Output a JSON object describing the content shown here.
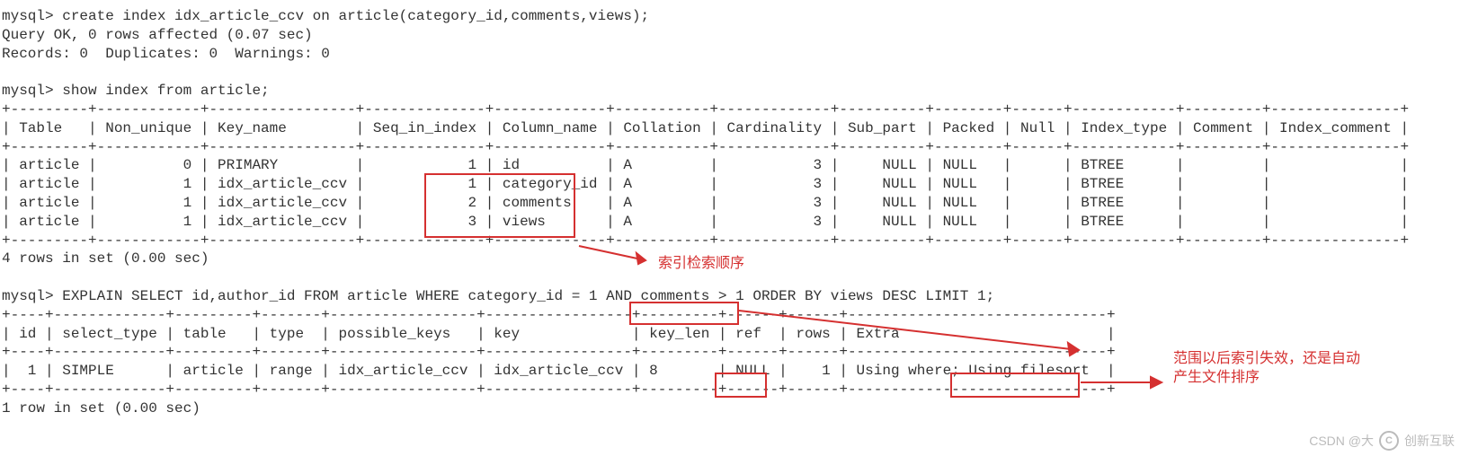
{
  "lines": {
    "l01": "mysql> create index idx_article_ccv on article(category_id,comments,views);",
    "l02": "Query OK, 0 rows affected (0.07 sec)",
    "l03": "Records: 0  Duplicates: 0  Warnings: 0",
    "l04": "",
    "l05": "mysql> show index from article;",
    "l06": "+---------+------------+-----------------+--------------+-------------+-----------+-------------+----------+--------+------+------------+---------+---------------+",
    "l07": "| Table   | Non_unique | Key_name        | Seq_in_index | Column_name | Collation | Cardinality | Sub_part | Packed | Null | Index_type | Comment | Index_comment |",
    "l08": "+---------+------------+-----------------+--------------+-------------+-----------+-------------+----------+--------+------+------------+---------+---------------+",
    "l09": "| article |          0 | PRIMARY         |            1 | id          | A         |           3 |     NULL | NULL   |      | BTREE      |         |               |",
    "l10": "| article |          1 | idx_article_ccv |            1 | category_id | A         |           3 |     NULL | NULL   |      | BTREE      |         |               |",
    "l11": "| article |          1 | idx_article_ccv |            2 | comments    | A         |           3 |     NULL | NULL   |      | BTREE      |         |               |",
    "l12": "| article |          1 | idx_article_ccv |            3 | views       | A         |           3 |     NULL | NULL   |      | BTREE      |         |               |",
    "l13": "+---------+------------+-----------------+--------------+-------------+-----------+-------------+----------+--------+------+------------+---------+---------------+",
    "l14": "4 rows in set (0.00 sec)",
    "l15": "",
    "l16": "mysql> EXPLAIN SELECT id,author_id FROM article WHERE category_id = 1 AND comments > 1 ORDER BY views DESC LIMIT 1;",
    "l17": "+----+-------------+---------+-------+-----------------+-----------------+---------+------+------+------------------------------+",
    "l18": "| id | select_type | table   | type  | possible_keys   | key             | key_len | ref  | rows | Extra                        |",
    "l19": "+----+-------------+---------+-------+-----------------+-----------------+---------+------+------+------------------------------+",
    "l20": "|  1 | SIMPLE      | article | range | idx_article_ccv | idx_article_ccv | 8       | NULL |    1 | Using where; Using filesort  |",
    "l21": "+----+-------------+---------+-------+-----------------+-----------------+---------+------+------+------------------------------+",
    "l22": "1 row in set (0.00 sec)"
  },
  "annot": {
    "a1": "索引检索顺序",
    "a2_l1": "范围以后索引失效，还是自动",
    "a2_l2": "产生文件排序"
  },
  "watermark": {
    "left": "CSDN @大",
    "brand": "创新互联"
  },
  "chart_data": {
    "type": "table",
    "tables": [
      {
        "title": "show index from article",
        "columns": [
          "Table",
          "Non_unique",
          "Key_name",
          "Seq_in_index",
          "Column_name",
          "Collation",
          "Cardinality",
          "Sub_part",
          "Packed",
          "Null",
          "Index_type",
          "Comment",
          "Index_comment"
        ],
        "rows": [
          [
            "article",
            0,
            "PRIMARY",
            1,
            "id",
            "A",
            3,
            "NULL",
            "NULL",
            "",
            "BTREE",
            "",
            ""
          ],
          [
            "article",
            1,
            "idx_article_ccv",
            1,
            "category_id",
            "A",
            3,
            "NULL",
            "NULL",
            "",
            "BTREE",
            "",
            ""
          ],
          [
            "article",
            1,
            "idx_article_ccv",
            2,
            "comments",
            "A",
            3,
            "NULL",
            "NULL",
            "",
            "BTREE",
            "",
            ""
          ],
          [
            "article",
            1,
            "idx_article_ccv",
            3,
            "views",
            "A",
            3,
            "NULL",
            "NULL",
            "",
            "BTREE",
            "",
            ""
          ]
        ]
      },
      {
        "title": "EXPLAIN SELECT id,author_id FROM article WHERE category_id = 1 AND comments > 1 ORDER BY views DESC LIMIT 1",
        "columns": [
          "id",
          "select_type",
          "table",
          "type",
          "possible_keys",
          "key",
          "key_len",
          "ref",
          "rows",
          "Extra"
        ],
        "rows": [
          [
            1,
            "SIMPLE",
            "article",
            "range",
            "idx_article_ccv",
            "idx_article_ccv",
            8,
            "NULL",
            1,
            "Using where; Using filesort"
          ]
        ]
      }
    ]
  }
}
